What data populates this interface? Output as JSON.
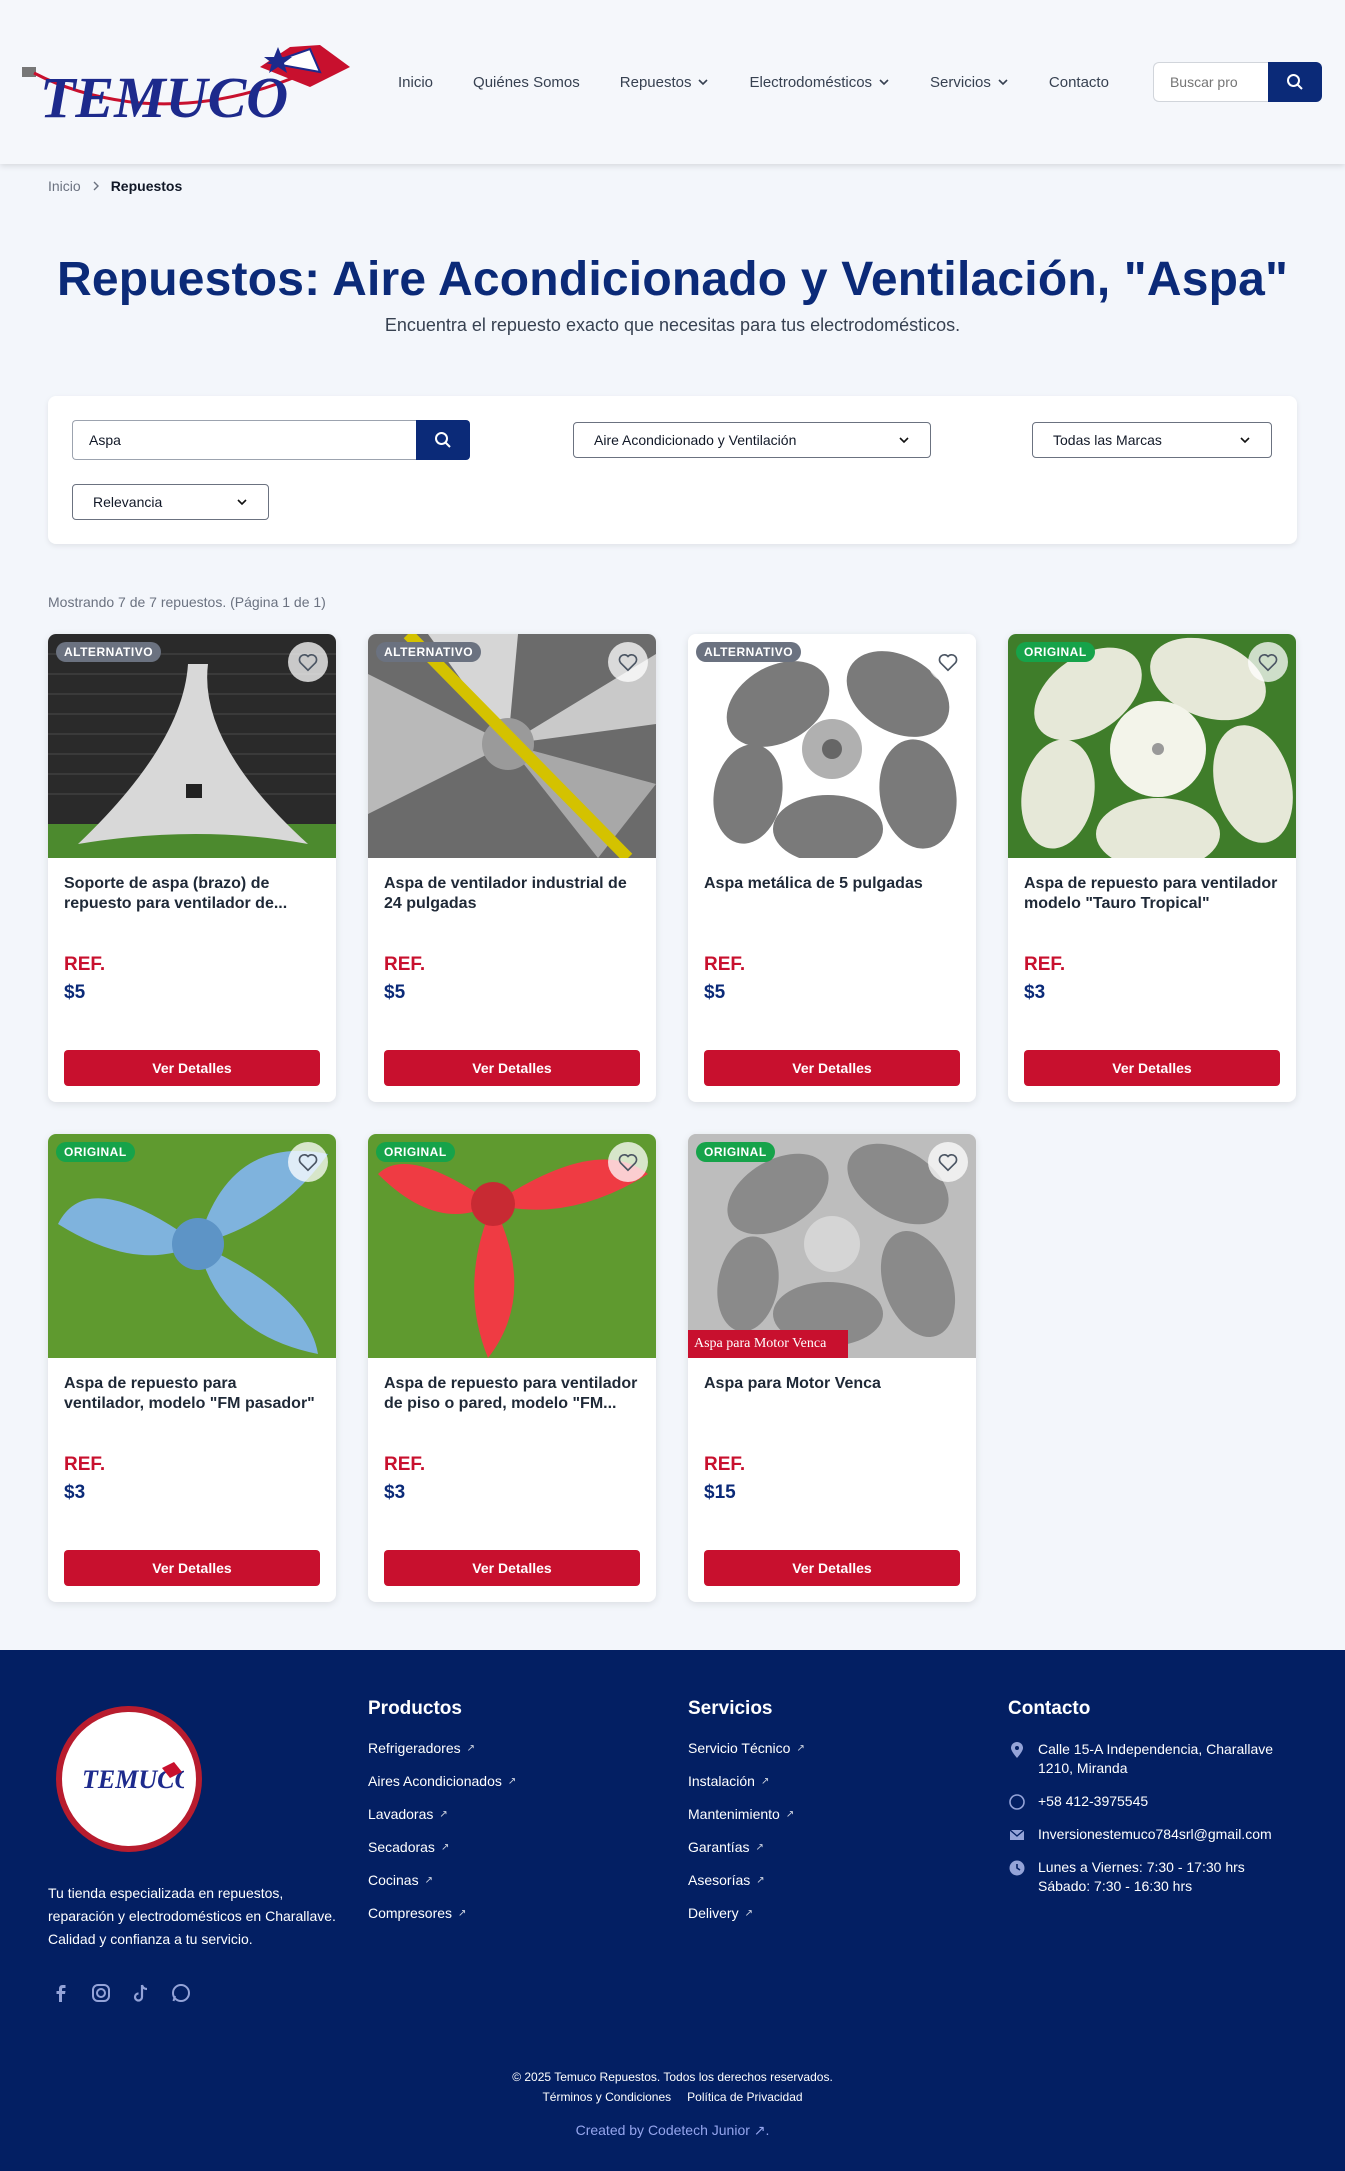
{
  "header": {
    "logo_text": "TEMUCO",
    "nav": [
      {
        "label": "Inicio",
        "dropdown": false
      },
      {
        "label": "Quiénes Somos",
        "dropdown": false
      },
      {
        "label": "Repuestos",
        "dropdown": true
      },
      {
        "label": "Electrodomésticos",
        "dropdown": true
      },
      {
        "label": "Servicios",
        "dropdown": true
      },
      {
        "label": "Contacto",
        "dropdown": false
      }
    ],
    "search_placeholder": "Buscar pro"
  },
  "breadcrumb": {
    "home": "Inicio",
    "current": "Repuestos"
  },
  "hero": {
    "title": "Repuestos: Aire Acondicionado y Ventilación, \"Aspa\"",
    "subtitle": "Encuentra el repuesto exacto que necesitas para tus electrodomésticos."
  },
  "filters": {
    "search_value": "Aspa",
    "category": "Aire Acondicionado y Ventilación",
    "brand": "Todas las Marcas",
    "sort": "Relevancia"
  },
  "results_text": "Mostrando 7 de 7 repuestos. (Página 1 de 1)",
  "products": [
    {
      "badge": "ALTERNATIVO",
      "type": "alt",
      "title": "Soporte de aspa (brazo) de repuesto para ventilador de...",
      "ref": "REF.",
      "price": "$5",
      "button": "Ver Detalles",
      "image": "fan-arm-support"
    },
    {
      "badge": "ALTERNATIVO",
      "type": "alt",
      "title": "Aspa de ventilador industrial de 24 pulgadas",
      "ref": "REF.",
      "price": "$5",
      "button": "Ver Detalles",
      "image": "industrial-blade"
    },
    {
      "badge": "ALTERNATIVO",
      "type": "alt",
      "title": "Aspa metálica de 5 pulgadas",
      "ref": "REF.",
      "price": "$5",
      "button": "Ver Detalles",
      "image": "metal-blade"
    },
    {
      "badge": "ORIGINAL",
      "type": "orig",
      "title": "Aspa de repuesto para ventilador modelo \"Tauro Tropical\"",
      "ref": "REF.",
      "price": "$3",
      "button": "Ver Detalles",
      "image": "white-blade"
    },
    {
      "badge": "ORIGINAL",
      "type": "orig",
      "title": "Aspa de repuesto para ventilador, modelo \"FM pasador\"",
      "ref": "REF.",
      "price": "$3",
      "button": "Ver Detalles",
      "image": "blue-blade"
    },
    {
      "badge": "ORIGINAL",
      "type": "orig",
      "title": "Aspa de repuesto para ventilador de piso o pared, modelo \"FM...",
      "ref": "REF.",
      "price": "$3",
      "button": "Ver Detalles",
      "image": "red-blade"
    },
    {
      "badge": "ORIGINAL",
      "type": "orig",
      "title": "Aspa para Motor Venca",
      "ref": "REF.",
      "price": "$15",
      "button": "Ver Detalles",
      "image": "motor-blade",
      "image_caption": "Aspa para Motor Venca"
    }
  ],
  "footer": {
    "about": "Tu tienda especializada en repuestos, reparación y electrodomésticos en Charallave. Calidad y confianza a tu servicio.",
    "productos_title": "Productos",
    "productos": [
      "Refrigeradores",
      "Aires Acondicionados",
      "Lavadoras",
      "Secadoras",
      "Cocinas",
      "Compresores"
    ],
    "servicios_title": "Servicios",
    "servicios": [
      "Servicio Técnico",
      "Instalación",
      "Mantenimiento",
      "Garantías",
      "Asesorías",
      "Delivery"
    ],
    "contacto_title": "Contacto",
    "address": "Calle 15-A Independencia, Charallave 1210, Miranda",
    "phone": "+58 412-3975545",
    "email": "Inversionestemuco784srl@gmail.com",
    "hours_1": "Lunes a Viernes: 7:30 - 17:30 hrs",
    "hours_2": "Sábado: 7:30 - 16:30 hrs",
    "copyright": "© 2025 Temuco Repuestos. Todos los derechos reservados.",
    "terms": "Términos y Condiciones",
    "privacy": "Política de Privacidad",
    "credit": "Created by Codetech Junior ↗."
  },
  "colors": {
    "brand_blue": "#0b2a78",
    "brand_red": "#c8102e",
    "footer_bg": "#031f63",
    "original_green": "#16a34a"
  }
}
